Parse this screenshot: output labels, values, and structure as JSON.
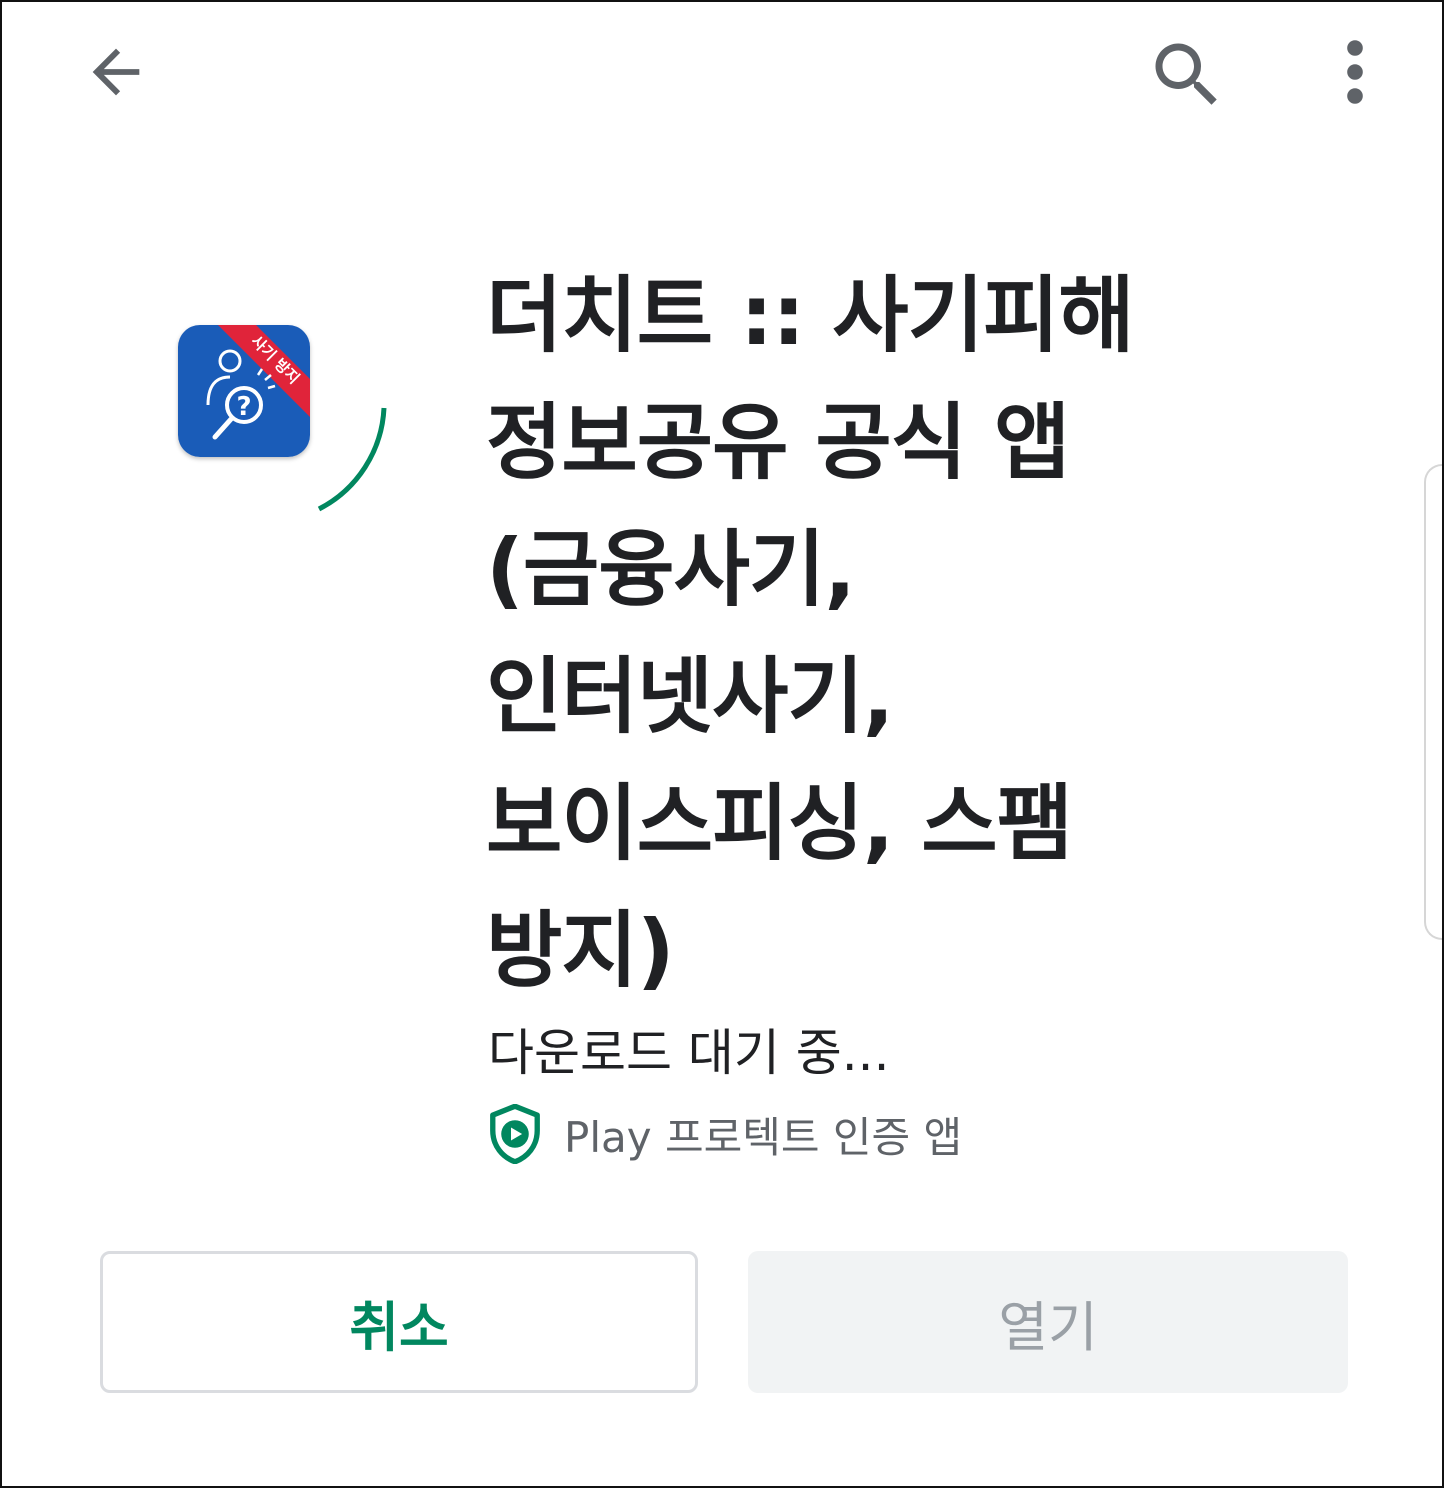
{
  "colors": {
    "accent_green": "#01875f",
    "text_primary": "#202124",
    "text_secondary": "#5f6368",
    "icon_blue": "#1a5cb8",
    "icon_ribbon_red": "#e0243a",
    "disabled_bg": "#f1f3f4",
    "disabled_text": "#9aa0a6"
  },
  "toolbar": {
    "back_icon": "arrow-back-icon",
    "search_icon": "search-icon",
    "more_icon": "more-vert-icon"
  },
  "app": {
    "icon_ribbon_text": "사기 방지",
    "title_lines": [
      "더치트 :: 사기피해",
      "정보공유 공식 앱",
      "(금융사기,",
      "인터넷사기,",
      "보이스피싱, 스팸",
      "방지)"
    ],
    "status": "다운로드 대기 중...",
    "protect_label": "Play 프로텍트 인증 앱"
  },
  "actions": {
    "cancel_label": "취소",
    "open_label": "열기"
  }
}
